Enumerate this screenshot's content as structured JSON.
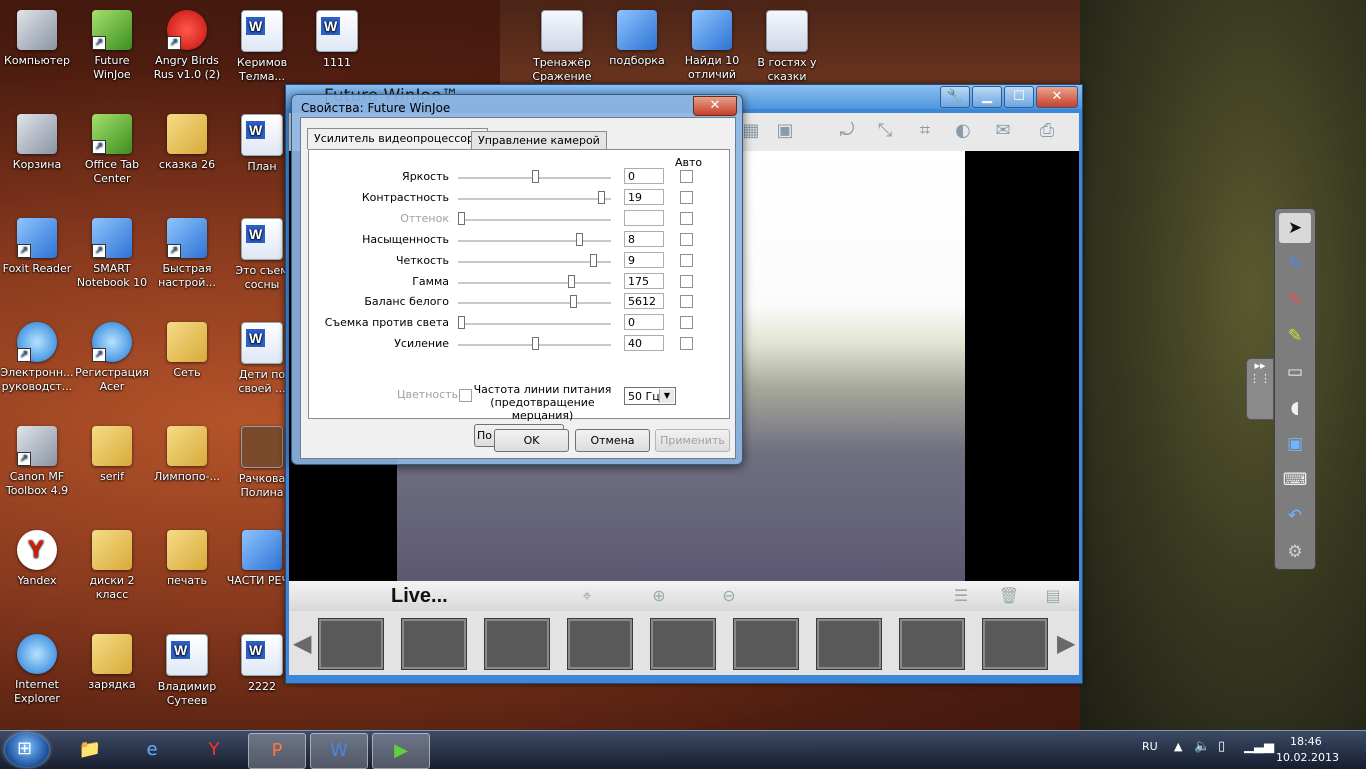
{
  "desktop_icons": [
    {
      "label": "Компьютер"
    },
    {
      "label": "Future WinJoe"
    },
    {
      "label": "Angry Birds Rus v1.0 (2)"
    },
    {
      "label": "Керимов Телма..."
    },
    {
      "label": "1111"
    },
    {
      "label": "Тренажёр Сражение"
    },
    {
      "label": "подборка"
    },
    {
      "label": "Найди 10 отличий"
    },
    {
      "label": "В гостях у сказки"
    },
    {
      "label": "Корзина"
    },
    {
      "label": "Office Tab Center"
    },
    {
      "label": "сказка 26"
    },
    {
      "label": "План"
    },
    {
      "label": "Foxit Reader"
    },
    {
      "label": "SMART Notebook 10"
    },
    {
      "label": "Быстрая настрой..."
    },
    {
      "label": "Это съем сосны"
    },
    {
      "label": "Электронн... руководст..."
    },
    {
      "label": "Регистрация Acer"
    },
    {
      "label": "Сеть"
    },
    {
      "label": "Дети по своей ..."
    },
    {
      "label": "Canon MF Toolbox 4.9"
    },
    {
      "label": "serif"
    },
    {
      "label": "Лимпопо-..."
    },
    {
      "label": "Рачкова Полина"
    },
    {
      "label": "Yandex"
    },
    {
      "label": "диски 2 класс"
    },
    {
      "label": "печать"
    },
    {
      "label": "ЧАСТИ РЕЧИ"
    },
    {
      "label": "Internet Explorer"
    },
    {
      "label": "зарядка"
    },
    {
      "label": "Владимир Сутеев"
    },
    {
      "label": "2222"
    }
  ],
  "app": {
    "title": "Future WinJoe™",
    "live_label": "Live..."
  },
  "dialog": {
    "title": "Свойства: Future WinJoe",
    "tabs": [
      "Усилитель видеопроцессора",
      "Управление камерой"
    ],
    "auto_header": "Авто",
    "rows": [
      {
        "label": "Яркость",
        "value": "0",
        "level": 0.5,
        "enabled": true
      },
      {
        "label": "Контрастность",
        "value": "19",
        "level": 0.95,
        "enabled": true
      },
      {
        "label": "Оттенок",
        "value": "",
        "level": 0.0,
        "enabled": false
      },
      {
        "label": "Насыщенность",
        "value": "8",
        "level": 0.8,
        "enabled": true
      },
      {
        "label": "Четкость",
        "value": "9",
        "level": 0.9,
        "enabled": true
      },
      {
        "label": "Гамма",
        "value": "175",
        "level": 0.75,
        "enabled": true
      },
      {
        "label": "Баланс белого",
        "value": "5612",
        "level": 0.76,
        "enabled": true
      },
      {
        "label": "Съемка против света",
        "value": "0",
        "level": 0.0,
        "enabled": true
      },
      {
        "label": "Усиление",
        "value": "40",
        "level": 0.5,
        "enabled": true
      }
    ],
    "color_label": "Цветность",
    "freq_label": "Частота линии питания (предотвращение мерцания)",
    "freq_value": "50 Гц",
    "default_button": "По умолчанию",
    "ok_button": "OK",
    "cancel_button": "Отмена",
    "apply_button": "Применить"
  },
  "taskbar": {
    "lang": "RU",
    "time": "18:46",
    "date": "10.02.2013"
  }
}
